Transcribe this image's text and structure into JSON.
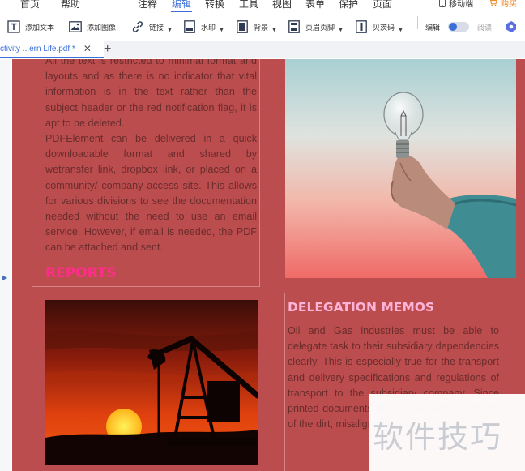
{
  "menu": {
    "items": [
      {
        "label": "首页",
        "active": false
      },
      {
        "label": "帮助",
        "active": false
      },
      {
        "label": "注释",
        "active": false
      },
      {
        "label": "编辑",
        "active": true
      },
      {
        "label": "转换",
        "active": false
      },
      {
        "label": "工具",
        "active": false
      },
      {
        "label": "视图",
        "active": false
      },
      {
        "label": "表单",
        "active": false
      },
      {
        "label": "保护",
        "active": false
      },
      {
        "label": "页面",
        "active": false
      }
    ],
    "mobile_label": "移动端",
    "buy_label": "购买"
  },
  "toolbar": {
    "add_text": "添加文本",
    "add_image": "添加图像",
    "link": "链接",
    "watermark": "水印",
    "background": "背景",
    "header_footer": "页眉页脚",
    "bates": "贝茨码",
    "edit_label": "编辑",
    "read_label": "阅读"
  },
  "tabs": {
    "active_tab_label": "ctivity ...ern Life.pdf *",
    "close_glyph": "✕",
    "add_glyph": "+"
  },
  "document": {
    "left_paragraphs": [
      "All the text is restricted to minimal format and layouts and as there is no indicator that vital information is in the text rather than the subject header or the red notification flag, it is apt to be deleted.",
      "PDFElement can be delivered in a quick downloadable format and shared by wetransfer link, dropbox link, or placed on a community/ company access site. This allows for various divisions to see the documentation needed without the need to use an email service. However, if email is needed, the PDF can be attached and sent."
    ],
    "reports_heading": "REPORTS",
    "delegation_heading": "DELEGATION MEMOS",
    "right_paragraph": "Oil and Gas industries must be able to delegate task to their subsidiary dependencies clearly. This is especially true for the transport and delivery specifications and regulations of transport to the subsidiary company. Since printed documents of elements which integrity of the dirt, misaligned having a",
    "colors": {
      "page_bg": "#bc4d4e",
      "text": "#6b2c2c",
      "reports_heading": "#ff2d8a",
      "delegation_heading": "#ffb3d9",
      "accent": "#3b6fd8"
    }
  },
  "watermark": {
    "text": "软件技巧"
  }
}
